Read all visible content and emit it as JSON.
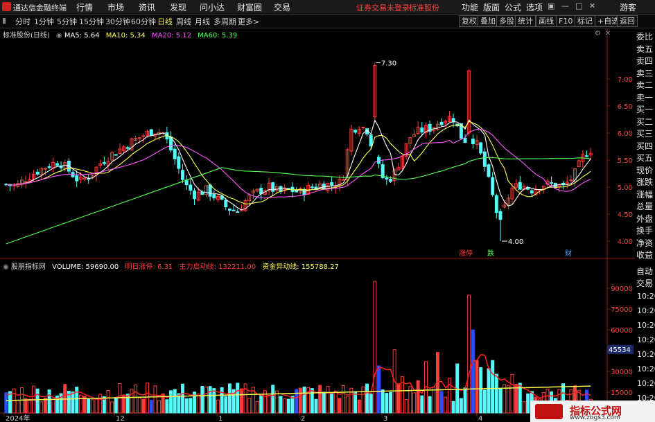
{
  "app": {
    "title": "通达信金融终端"
  },
  "menu": [
    "行情",
    "市场",
    "资讯",
    "发现",
    "问小达",
    "财富圈",
    "交易"
  ],
  "alert": {
    "left": "证券交易未登录",
    "right": "标准股份"
  },
  "menu_right": [
    "功能",
    "版面",
    "公式",
    "选项"
  ],
  "user": "游客",
  "periods": [
    "分时",
    "1分钟",
    "5分钟",
    "15分钟",
    "30分钟",
    "60分钟",
    "日线",
    "周线",
    "月线",
    "多周期",
    "更多>"
  ],
  "active_period": "日线",
  "tools": [
    "复权",
    "叠加",
    "多股",
    "统计",
    "画线",
    "F10",
    "标记",
    "+自选",
    "返回"
  ],
  "main_legend": {
    "stock": "标准股份(日线)",
    "ma5": "MA5: 5.64",
    "ma10": "MA10: 5.34",
    "ma20": "MA20: 5.12",
    "ma60": "MA60: 5.39"
  },
  "vol_legend": {
    "name": "股朋指标网",
    "volume": "VOLUME: 59690.00",
    "tomorrow": "明日涨停: 6.31",
    "main_force": "主力启动线: 132211.00",
    "capital": "资金异动线: 155788.27"
  },
  "price_axis": [
    "7.00",
    "6.50",
    "6.00",
    "5.50",
    "5.00",
    "4.50",
    "4.00"
  ],
  "vol_axis": [
    "90000",
    "75000",
    "60000",
    "45000",
    "30000",
    "15000"
  ],
  "vol_tag": "45534",
  "annotations": {
    "high": "7.30",
    "low": "4.00",
    "mark1": "涨停",
    "mark2": "跌",
    "mark3": "财"
  },
  "date_axis": [
    "2024年",
    "12",
    "1",
    "2",
    "3",
    "4"
  ],
  "side_panel": [
    "委比",
    "卖五",
    "卖四",
    "卖三",
    "卖二",
    "卖一",
    "买一",
    "买二",
    "买三",
    "买四",
    "买五",
    "现价",
    "涨跌",
    "涨幅",
    "总量",
    "外盘",
    "换手",
    "净资",
    "收益"
  ],
  "side_panel2": [
    "自动",
    "交易"
  ],
  "times": [
    "10:20",
    "10:20",
    "10:20",
    "10:20",
    "10:20",
    "10:20",
    "10:20",
    "10:20",
    "10:20"
  ],
  "colors": {
    "up": "#ff3c3c",
    "down": "#54fcfc",
    "ma5": "#ffffff",
    "ma10": "#ffff54",
    "ma20": "#ff54ff",
    "ma60": "#54ff54",
    "accent": "#e9e95a"
  },
  "watermark": {
    "title": "指标公式网",
    "url": "www.zbgs3.com"
  }
}
